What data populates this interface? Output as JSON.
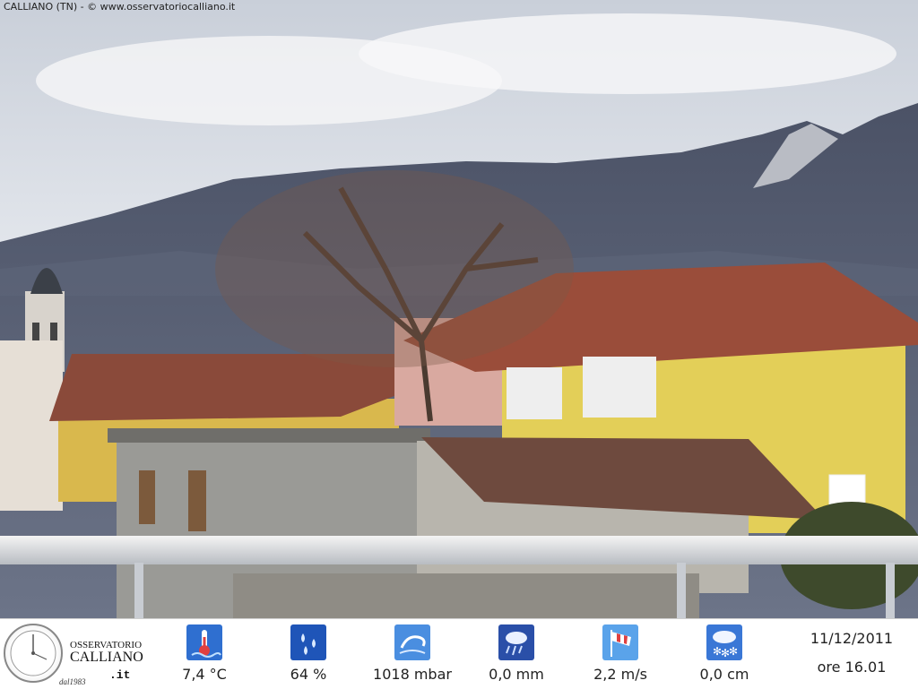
{
  "caption": "CALLIANO (TN) - © www.osservatoriocalliano.it",
  "logo": {
    "line1": "OSSERVATORIO",
    "line2": "CALLIANO",
    "line3": ".it",
    "line4": "dal1983"
  },
  "readings": [
    {
      "name": "temperature",
      "icon": "thermometer-icon",
      "value": "7,4 °C"
    },
    {
      "name": "humidity",
      "icon": "humidity-drops-icon",
      "value": "64 %"
    },
    {
      "name": "pressure",
      "icon": "pressure-icon",
      "value": "1018 mbar"
    },
    {
      "name": "rain",
      "icon": "rain-cloud-icon",
      "value": "0,0 mm"
    },
    {
      "name": "wind",
      "icon": "windsock-icon",
      "value": "2,2 m/s"
    },
    {
      "name": "snow",
      "icon": "snow-cloud-icon",
      "value": "0,0 cm"
    }
  ],
  "date": "11/12/2011",
  "time": "ore 16.01",
  "colors": {
    "icon_blue": "#2f6fd0",
    "text": "#222222"
  }
}
